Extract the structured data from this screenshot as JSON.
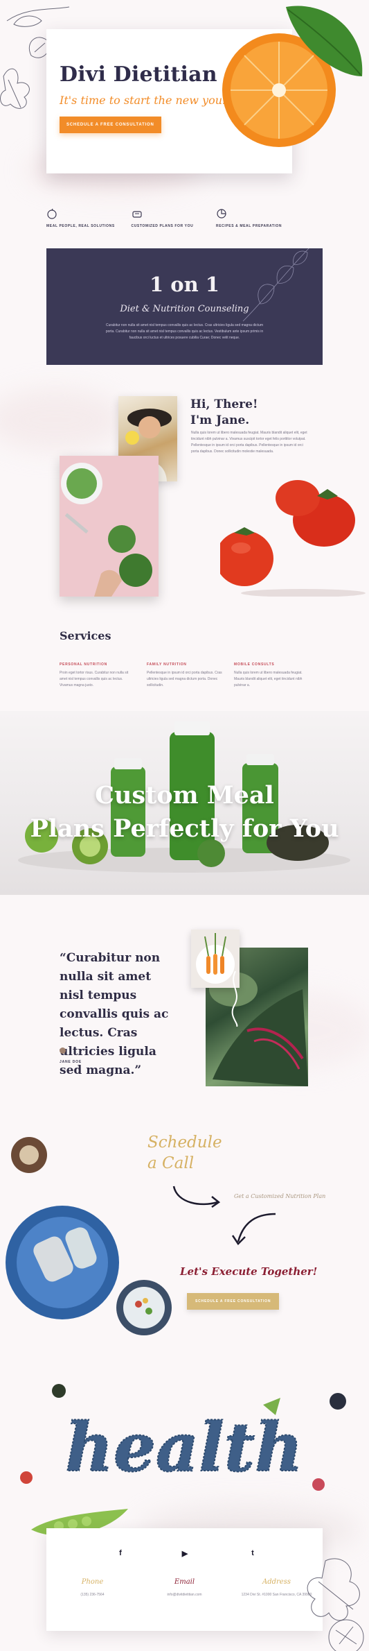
{
  "hero": {
    "title": "Divi Dietitian",
    "subtitle": "It's time to start the new you!",
    "cta": "SCHEDULE A FREE CONSULTATION"
  },
  "features": [
    {
      "icon": "apple-icon",
      "label": "MEAL PEOPLE, REAL SOLUTIONS"
    },
    {
      "icon": "scale-icon",
      "label": "CUSTOMIZED PLANS FOR YOU"
    },
    {
      "icon": "pie-chart-icon",
      "label": "RECIPES & MEAL PREPARATION"
    }
  ],
  "banner": {
    "title": "1 on 1",
    "subtitle": "Diet & Nutrition Counseling",
    "body": "Curabitur non nulla sit amet nisl tempus convallis quis ac lectus. Cras ultricies ligula sed magna dictum porta. Curabitur non nulla sit amet nisl tempus convallis quis ac lectus. Vestibulum ante ipsum primis in faucibus orci luctus et ultrices posuere cubilia Curae; Donec velit neque."
  },
  "about": {
    "heading_line1": "Hi, There!",
    "heading_line2": "I'm Jane.",
    "body": "Nulla quis lorem ut libero malesuada feugiat. Mauris blandit aliquet elit, eget tincidunt nibh pulvinar a. Vivamus suscipit tortor eget felis porttitor volutpat. Pellentesque in ipsum id orci porta dapibus. Pellentesque in ipsum id orci porta dapibus. Donec sollicitudin molestie malesuada."
  },
  "services": {
    "title": "Services",
    "items": [
      {
        "title": "PERSONAL NUTRITION",
        "body": "Proin eget tortor risus. Curabitur non nulla sit amet nisl tempus convallis quis ac lectus. Vivamus magna justo."
      },
      {
        "title": "FAMILY NUTRITION",
        "body": "Pellentesque in ipsum id orci porta dapibus. Cras ultricies ligula sed magna dictum porta. Donec sollicitudin."
      },
      {
        "title": "MOBILE CONSULTS",
        "body": "Nulla quis lorem ut libero malesuada feugiat. Mauris blandit aliquet elit, eget tincidunt nibh pulvinar a."
      }
    ]
  },
  "meal": {
    "title_line1": "Custom Meal",
    "title_line2": "Plans Perfectly for You"
  },
  "testimonial": {
    "quote": "“Curabitur non nulla sit amet nisl tempus convallis quis ac lectus. Cras ultricies ligula sed magna.”",
    "author": "JANE DOE"
  },
  "schedule": {
    "title_line1": "Schedule",
    "title_line2": "a Call",
    "note": "Get a Customized Nutrition Plan",
    "execute": "Let's Execute Together!",
    "cta": "SCHEDULE A FREE CONSULTATION"
  },
  "health_word": "health",
  "footer": {
    "social": [
      {
        "icon": "facebook-icon",
        "glyph": "f"
      },
      {
        "icon": "youtube-icon",
        "glyph": "▶"
      },
      {
        "icon": "twitter-icon",
        "glyph": "t"
      }
    ],
    "contacts": [
      {
        "label": "Phone",
        "value": "(135) 236-7564",
        "color": "#d6b163"
      },
      {
        "label": "Email",
        "value": "info@divitdietitian.com",
        "color": "#8b1f33"
      },
      {
        "label": "Address",
        "value": "1234 Divi St. #1000 San Francisco, CA 39980",
        "color": "#d6b163"
      }
    ]
  },
  "colors": {
    "navy": "#3b3956",
    "orange": "#f28c28",
    "gold": "#d6b978",
    "burgundy": "#8b1f33"
  }
}
